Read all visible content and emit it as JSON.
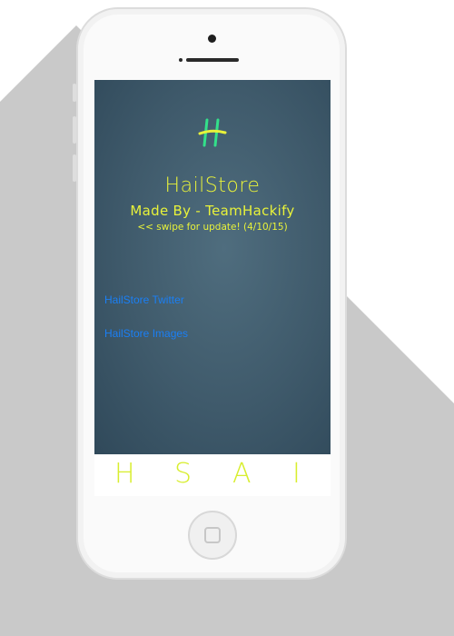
{
  "screen": {
    "logo_icon": "h-logo-icon",
    "title": "HailStore",
    "subtitle": "Made By - TeamHackify",
    "note": "<< swipe for update! (4/10/15)",
    "links": [
      {
        "label": "HailStore Twitter"
      },
      {
        "label": "HailStore Images"
      }
    ]
  },
  "dock": {
    "letters": [
      "H",
      "S",
      "A",
      "I"
    ]
  },
  "colors": {
    "accent_yellow": "#e8f23a",
    "accent_green": "#33e08a",
    "link_blue": "#1a7ff5",
    "screen_bg": "#3f5a6b"
  }
}
